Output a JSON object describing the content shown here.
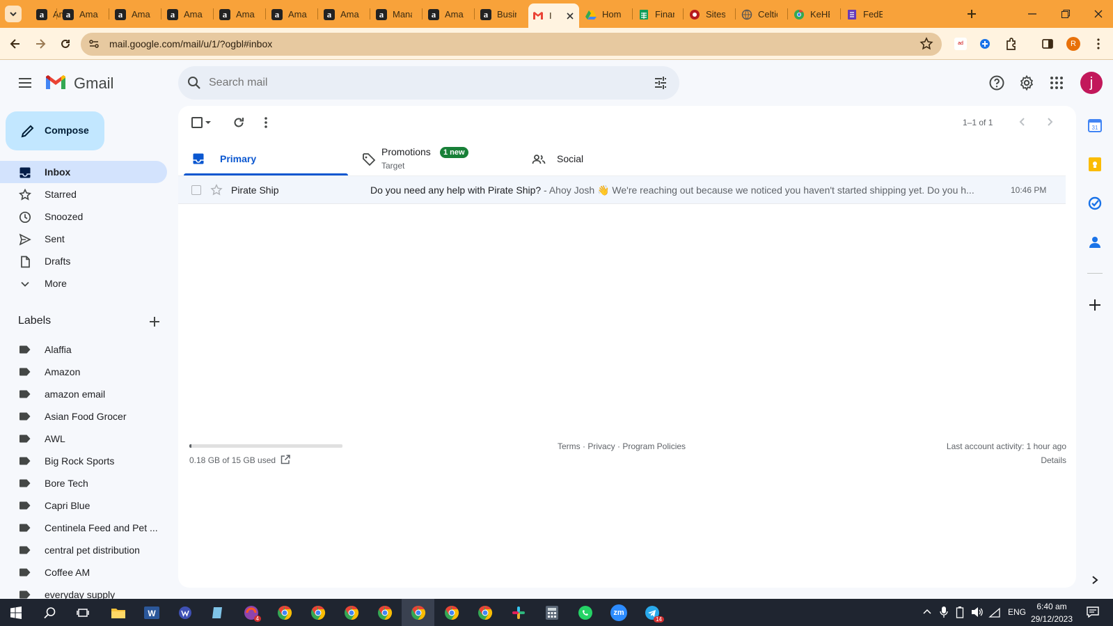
{
  "browser": {
    "tabs": [
      {
        "title": "Amazon",
        "icon": "amazon-icon"
      },
      {
        "title": "Amazon",
        "icon": "amazon-icon"
      },
      {
        "title": "Amazon",
        "icon": "amazon-icon"
      },
      {
        "title": "Amazon",
        "icon": "amazon-icon"
      },
      {
        "title": "Amazon",
        "icon": "amazon-icon"
      },
      {
        "title": "Amazon",
        "icon": "amazon-icon"
      },
      {
        "title": "Amazon",
        "icon": "amazon-icon"
      },
      {
        "title": "Manage",
        "icon": "amazon-icon"
      },
      {
        "title": "Amazon",
        "icon": "amazon-icon"
      },
      {
        "title": "Business",
        "icon": "amazon-icon"
      },
      {
        "title": "Inbox",
        "icon": "gmail-icon",
        "active": true
      },
      {
        "title": "Home",
        "icon": "drive-icon"
      },
      {
        "title": "Finance",
        "icon": "sheets-icon"
      },
      {
        "title": "Sites",
        "icon": "sites-icon"
      },
      {
        "title": "Celtic",
        "icon": "globe-icon"
      },
      {
        "title": "KeHE",
        "icon": "chrome-icon"
      },
      {
        "title": "FedEx",
        "icon": "forms-icon"
      }
    ],
    "tab_labels": [
      "Ama:",
      "Ama:",
      "Ama:",
      "Ama:",
      "Ama:",
      "Ama:",
      "Ama:",
      "Mana",
      "Ama:",
      "Busin",
      "I",
      "Hom",
      "Finan",
      "Sites",
      "Celtic",
      "KeHE",
      "FedE"
    ],
    "url": "mail.google.com/mail/u/1/?ogbl#inbox",
    "profile_initial": "R",
    "accent": "#f8a23a"
  },
  "gmail": {
    "brand": "Gmail",
    "search_placeholder": "Search mail",
    "avatar_initial": "j",
    "compose_label": "Compose",
    "nav": [
      {
        "label": "Inbox",
        "icon": "inbox-icon",
        "selected": true
      },
      {
        "label": "Starred",
        "icon": "star-icon"
      },
      {
        "label": "Snoozed",
        "icon": "clock-icon"
      },
      {
        "label": "Sent",
        "icon": "send-icon"
      },
      {
        "label": "Drafts",
        "icon": "draft-icon"
      },
      {
        "label": "More",
        "icon": "chevron-down-icon"
      }
    ],
    "labels_heading": "Labels",
    "labels": [
      "Alaffia",
      "Amazon",
      "amazon email",
      "Asian Food Grocer",
      "AWL",
      "Big Rock Sports",
      "Bore Tech",
      "Capri Blue",
      "Centinela Feed and Pet ...",
      "central pet distribution",
      "Coffee AM",
      "everyday supply"
    ],
    "pagination": "1–1 of 1",
    "tabs": {
      "primary": "Primary",
      "promotions": "Promotions",
      "promotions_badge": "1 new",
      "promotions_sub": "Target",
      "social": "Social"
    },
    "emails": [
      {
        "sender": "Pirate Ship",
        "subject": "Do you need any help with Pirate Ship?",
        "snippet": " - Ahoy Josh 👋 We're reaching out because we noticed you haven't started shipping yet. Do you h...",
        "time": "10:46 PM"
      }
    ],
    "storage": {
      "text": "0.18 GB of 15 GB used",
      "used_fraction": 0.012
    },
    "footer_links": "Terms · Privacy · Program Policies",
    "activity": "Last account activity: 1 hour ago",
    "details": "Details"
  },
  "taskbar": {
    "lang": "ENG",
    "time": "6:40 am",
    "date": "29/12/2023",
    "zoom_label": "zm",
    "badges": {
      "app4": "4",
      "telegram": "14"
    }
  }
}
